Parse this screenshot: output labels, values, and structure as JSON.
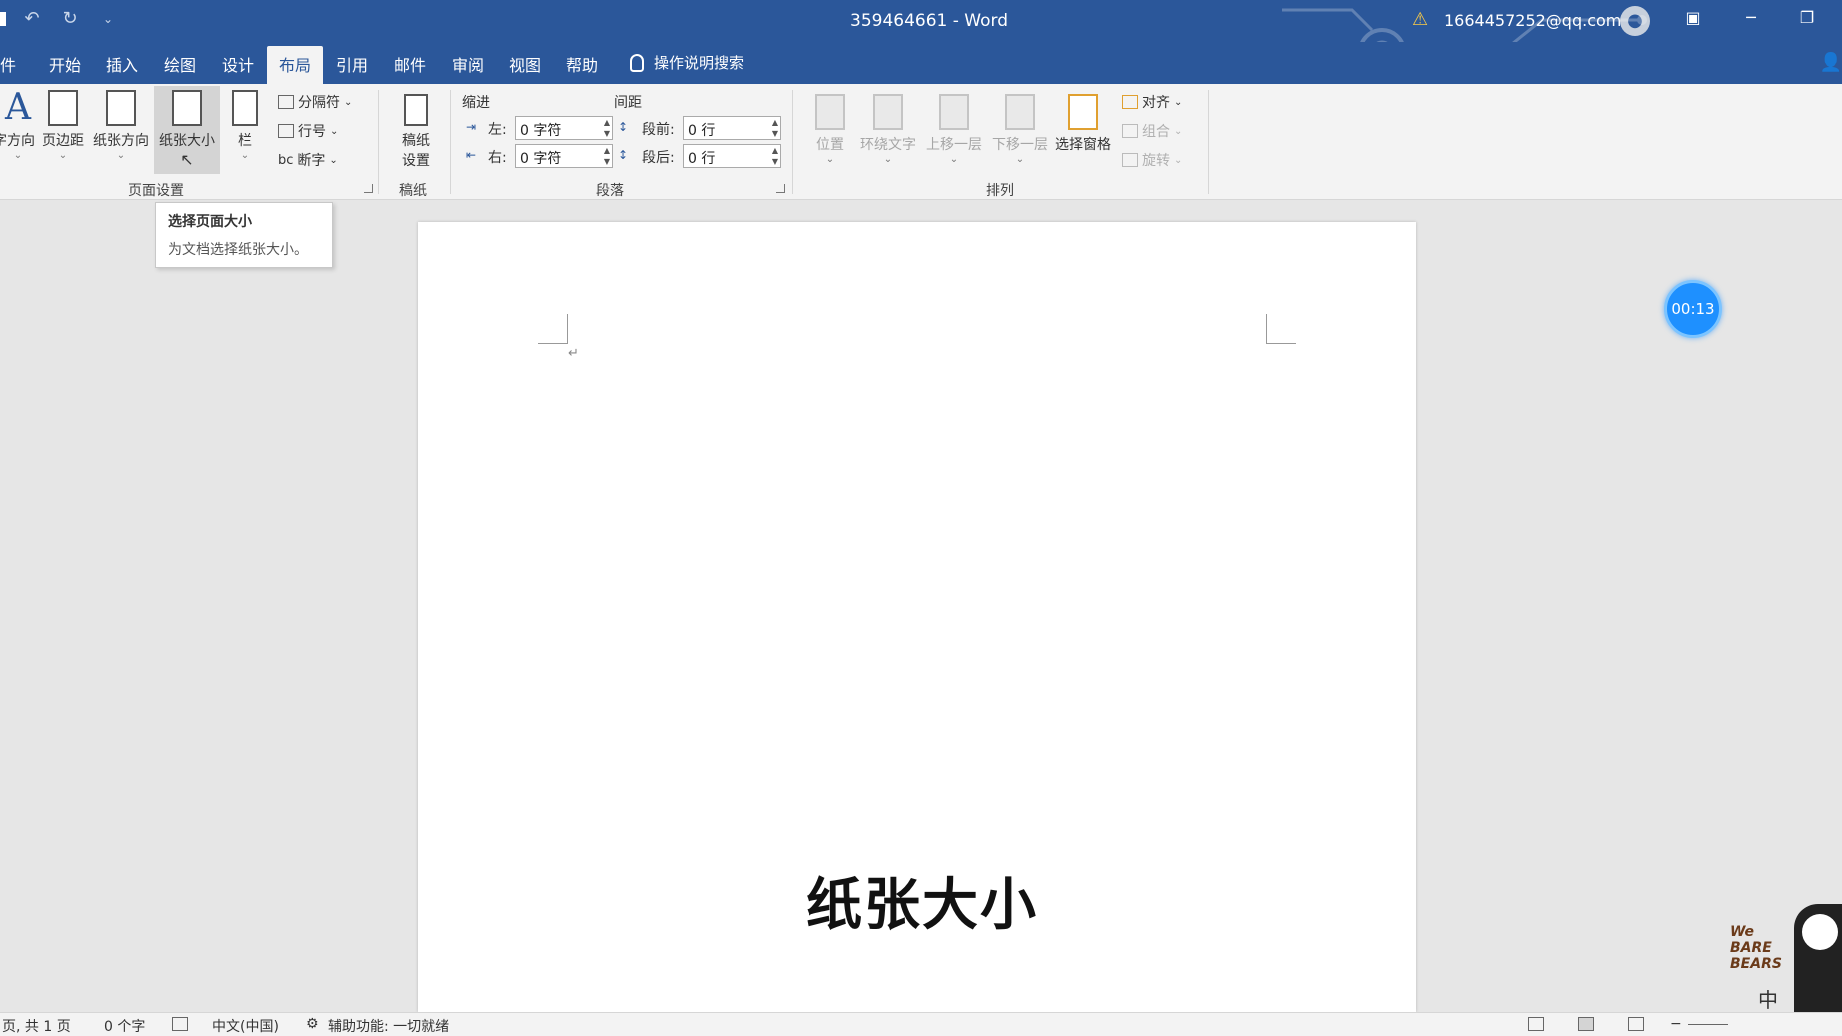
{
  "titlebar": {
    "doc_title": "359464661 - Word",
    "account": "1664457252@qq.com",
    "qat_undo": "↶",
    "qat_redo": "↻",
    "qat_customize": "⌄",
    "minimize": "─",
    "restore": "❐",
    "ribbon_display": "▣"
  },
  "tabs": {
    "file": "件",
    "home": "开始",
    "insert": "插入",
    "draw": "绘图",
    "design": "设计",
    "layout": "布局",
    "references": "引用",
    "mailings": "邮件",
    "review": "审阅",
    "view": "视图",
    "help": "帮助",
    "tell_me": "操作说明搜索"
  },
  "ribbon": {
    "text_direction": "字方向",
    "margins": "页边距",
    "orientation": "纸张方向",
    "size": "纸张大小",
    "columns": "栏",
    "breaks": "分隔符",
    "line_numbers": "行号",
    "hyphenation": "断字",
    "page_setup_group": "页面设置",
    "manuscript_setup_line1": "稿纸",
    "manuscript_setup_line2": "设置",
    "manuscript_group": "稿纸",
    "indent_header": "缩进",
    "spacing_header": "间距",
    "indent_left_label": "左:",
    "indent_left_value": "0 字符",
    "indent_right_label": "右:",
    "indent_right_value": "0 字符",
    "space_before_label": "段前:",
    "space_before_value": "0 行",
    "space_after_label": "段后:",
    "space_after_value": "0 行",
    "paragraph_group": "段落",
    "position": "位置",
    "wrap_text": "环绕文字",
    "bring_forward": "上移一层",
    "send_backward": "下移一层",
    "selection_pane": "选择窗格",
    "align": "对齐",
    "group": "组合",
    "rotate": "旋转",
    "arrange_group": "排列"
  },
  "tooltip": {
    "title": "选择页面大小",
    "body": "为文档选择纸张大小。"
  },
  "document": {
    "paragraph_mark": "↵"
  },
  "overlay": {
    "subtitle": "纸张大小",
    "timer": "00:13",
    "watermark_text": "We BARE BEARS",
    "ime_indicator": "中"
  },
  "statusbar": {
    "page": "页, 共 1 页",
    "words": "0 个字",
    "language": "中文(中国)",
    "accessibility": "辅助功能: 一切就绪",
    "zoom_minus": "−"
  }
}
